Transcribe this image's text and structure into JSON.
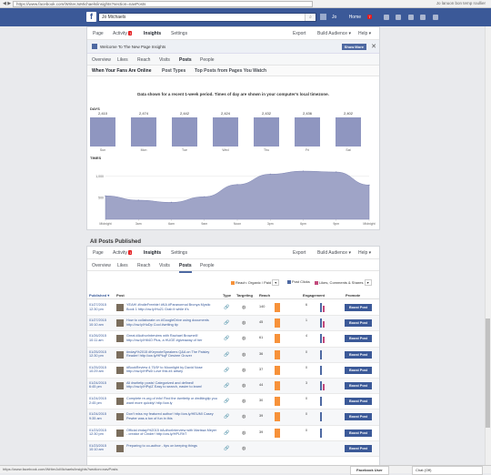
{
  "browser": {
    "url": "https://www.facebook.com/WriterJoMichaels/insights?section=navPosts",
    "right_text": "Jo  lanuon  bon  temp  roullier",
    "nav": "◀ ▶ ↻"
  },
  "fb": {
    "logo": "f",
    "search_value": "Jo Michaels",
    "user": "Jo",
    "home": "Home",
    "home_count": "7"
  },
  "page_menu": {
    "page": "Page",
    "activity": "Activity",
    "activity_count": "1",
    "insights": "Insights",
    "settings": "Settings",
    "export": "Export",
    "build_audience": "Build Audience ▾",
    "help": "Help ▾"
  },
  "banner": {
    "text": "Welcome To The New Page Insights",
    "button": "Show More",
    "close": "✕"
  },
  "subtabs": [
    "Overview",
    "Likes",
    "Reach",
    "Visits",
    "Posts",
    "People"
  ],
  "post_tabs": [
    "When Your Fans Are Online",
    "Post Types",
    "Top Posts from Pages You Watch"
  ],
  "notice": "Data shown for a recent 1-week period. Times of day are shown in your computer's local timezone.",
  "days_label": "DAYS",
  "days": [
    {
      "label": "Sun",
      "value": "2,410"
    },
    {
      "label": "Mon",
      "value": "2,474"
    },
    {
      "label": "Tue",
      "value": "2,442"
    },
    {
      "label": "Wed",
      "value": "2,424"
    },
    {
      "label": "Thu",
      "value": "2,432"
    },
    {
      "label": "Fri",
      "value": "2,436"
    },
    {
      "label": "Sat",
      "value": "2,402"
    }
  ],
  "times_label": "TIMES",
  "chart_data": {
    "type": "area",
    "title": "TIMES",
    "x": [
      "Midnight",
      "3am",
      "6am",
      "9am",
      "Noon",
      "3pm",
      "6pm",
      "9pm",
      "Midnight"
    ],
    "series": [
      {
        "values": [
          540,
          440,
          390,
          520,
          800,
          1040,
          1110,
          1090,
          790
        ]
      }
    ],
    "yticks": [
      "1,000",
      "500"
    ],
    "ylim": [
      0,
      1300
    ],
    "color": "#9fa4c7"
  },
  "all_posts": {
    "title": "All Posts Published"
  },
  "legend": {
    "reach": "Reach: Organic / Paid",
    "clicks": "Post Clicks",
    "likes": "Likes, Comments & Shares",
    "reach_color": "#f7923a",
    "clicks_color": "#4e69a2",
    "likes_color": "#c34a7c"
  },
  "table_headers": {
    "published": "Published ▾",
    "post": "Post",
    "type": "Type",
    "targeting": "Targeting",
    "reach": "Reach",
    "engagement": "Engagement",
    "promote": "Promote"
  },
  "rows": [
    {
      "date": "01/27/2015",
      "time": "12:30 pm",
      "text": "YEAH! #IndieFreebie! #KA #Paranormal Bronya Mystic Book 1 http://ow.ly/Hu21 Grab it while it's",
      "reach": "140",
      "eng": "6",
      "boost": "Boost Post"
    },
    {
      "date": "01/27/2015",
      "time": "10:10 am",
      "text": "How to collaborate on #GoogleDrive using documents http://ow.ly/HuDp Cool #writing tip",
      "reach": "45",
      "eng": "1",
      "boost": "Boost Post"
    },
    {
      "date": "01/26/2015",
      "time": "10:11 am",
      "text": "Great #AuthorInterview with Rachael Brownell! http://ow.ly/HtI4O Plus, a HUGE #giveaway of her",
      "reach": "61",
      "eng": "4",
      "boost": "Boost Post"
    },
    {
      "date": "01/25/2015",
      "time": "12:30 pm",
      "text": "#nday!%2015 #KeynoteSpeakers Q&A on The Paisley Reader! http://ow.ly/HPkqF Desiree Grover",
      "reach": "36",
      "eng": "0",
      "boost": "Boost Post"
    },
    {
      "date": "01/25/2015",
      "time": "10:29 am",
      "text": "#BookReview 4.75/5* to Moonlight by David Nose http://ow.ly/HPs0i Love this #4 artsey",
      "reach": "37",
      "eng": "0",
      "boost": "Boost Post"
    },
    {
      "date": "01/24/2015",
      "time": "6:45 pm",
      "text": "All #writetip posts! Categorized and defined! http://ow.ly/HPqIZ Easy to search, easier to learn!",
      "reach": "44",
      "eng": "3",
      "boost": "Boost Post"
    },
    {
      "date": "01/24/2015",
      "time": "2:45 pm",
      "text": "Complete re-org of info! Find the #writetip or #editingtip you want more quickly! http://ow.ly",
      "reach": "30",
      "eng": "0",
      "boost": "Boost Post"
    },
    {
      "date": "01/24/2015",
      "time": "9:35 am",
      "text": "Don't miss my featured author! http://ow.ly/HEUMI Casey Pewter was a ton of fun in this",
      "reach": "39",
      "eng": "0",
      "boost": "Boost Post"
    },
    {
      "date": "01/23/2015",
      "time": "12:30 pm",
      "text": "Official #nday!%2015 #AuthorInterview with Marissa Meyer - creator of Cinder! http://ow.ly/HPLRhT",
      "reach": "39",
      "eng": "0",
      "boost": "Boost Post"
    },
    {
      "date": "01/23/2015",
      "time": "10:10 am",
      "text": "Preparing to co-author - tips on keeping things",
      "reach": "",
      "eng": "",
      "boost": "Boost Post"
    }
  ],
  "status": {
    "url": "https://www.facebook.com/WriterJoMichaels/insights?section=navPosts",
    "fb_user": "Facebook User",
    "chat": "Chat (Off)"
  }
}
